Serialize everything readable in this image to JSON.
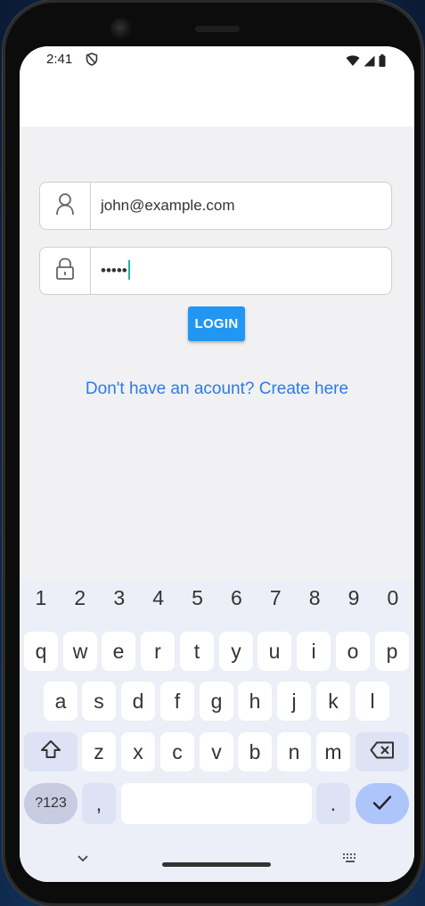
{
  "status_bar": {
    "time": "2:41",
    "icons": [
      "shield-icon",
      "wifi-icon",
      "signal-icon",
      "battery-icon"
    ]
  },
  "login_form": {
    "email_value": "john@example.com",
    "email_icon": "user-icon",
    "password_value": "•••••",
    "password_icon": "lock-icon",
    "login_label": "LOGIN",
    "signup_link": "Don't have an acount? Create here"
  },
  "keyboard": {
    "number_row": [
      "1",
      "2",
      "3",
      "4",
      "5",
      "6",
      "7",
      "8",
      "9",
      "0"
    ],
    "row1": [
      "q",
      "w",
      "e",
      "r",
      "t",
      "y",
      "u",
      "i",
      "o",
      "p"
    ],
    "row2": [
      "a",
      "s",
      "d",
      "f",
      "g",
      "h",
      "j",
      "k",
      "l"
    ],
    "row3": [
      "z",
      "x",
      "c",
      "v",
      "b",
      "n",
      "m"
    ],
    "symbols_label": "?123",
    "comma_label": ",",
    "period_label": ".",
    "shift_icon": "shift-icon",
    "backspace_icon": "backspace-icon",
    "done_icon": "check-icon",
    "hide_icon": "chevron-down-icon",
    "switch_icon": "keyboard-icon"
  },
  "colors": {
    "accent": "#2196f3",
    "link": "#2c7be5",
    "caret": "#1fb3a3"
  }
}
